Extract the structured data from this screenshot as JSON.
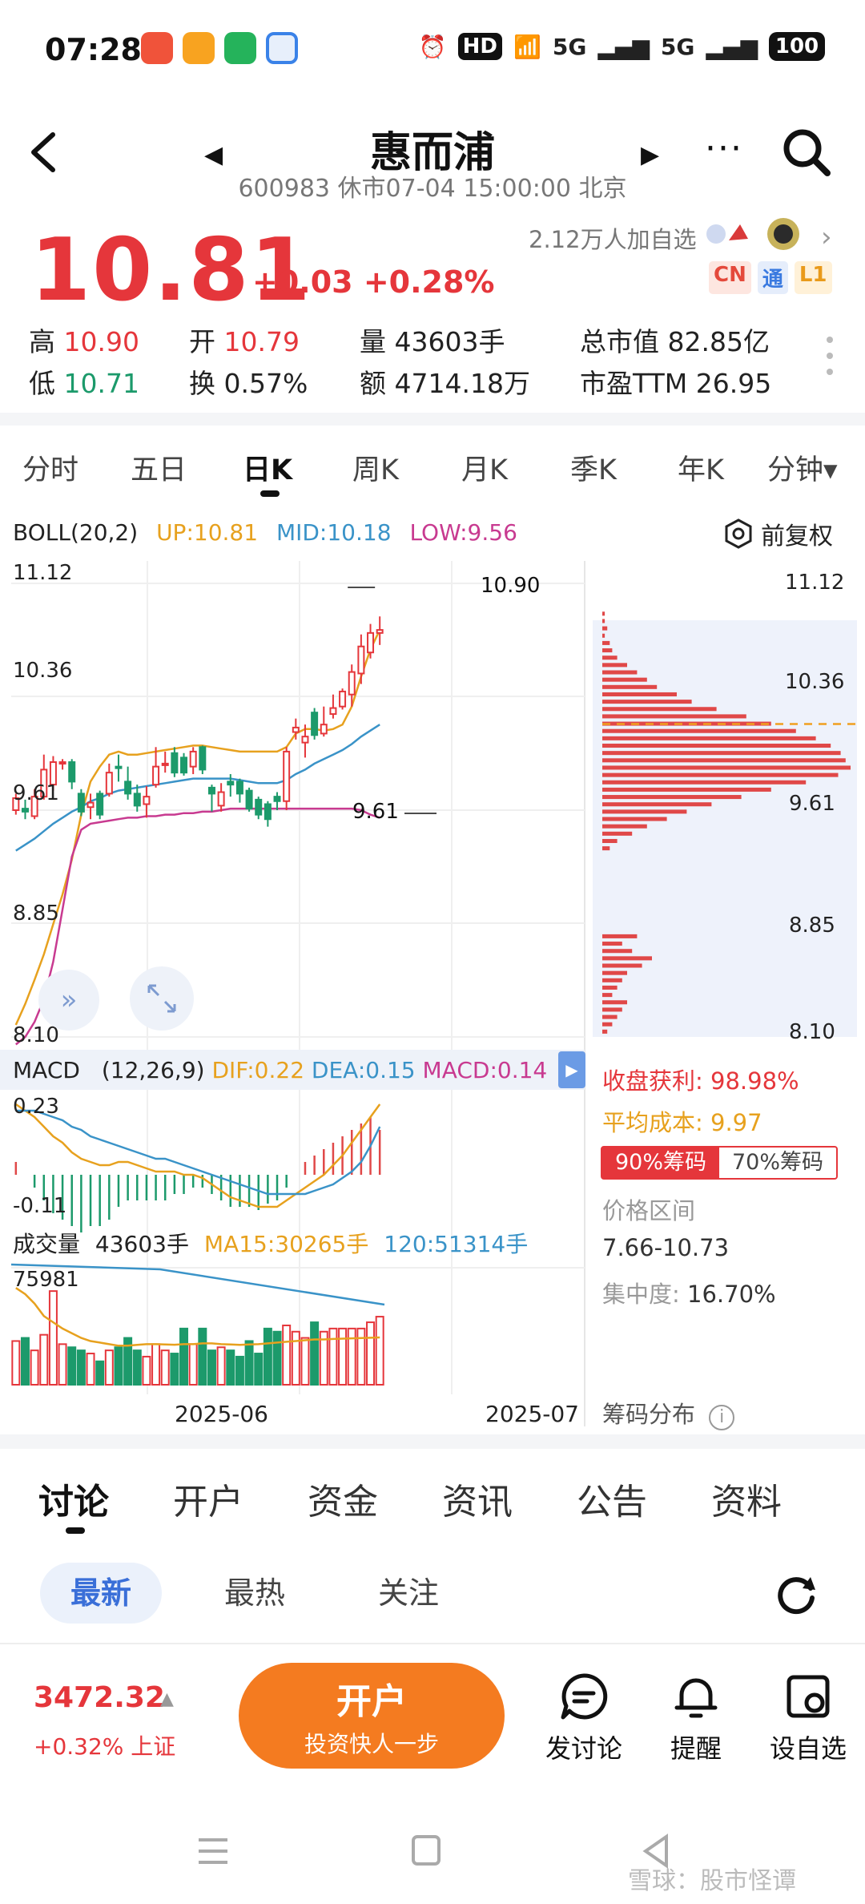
{
  "status_bar": {
    "time": "07:28",
    "hd": "HD",
    "net1": "5G",
    "net2": "5G",
    "battery": "100"
  },
  "header": {
    "title": "惠而浦",
    "subtitle": "600983 休市07-04 15:00:00 北京"
  },
  "quote": {
    "price": "10.81",
    "change": "+0.03 +0.28%",
    "watchers": "2.12万人加自选",
    "badges": [
      "CN",
      "通",
      "L1"
    ]
  },
  "stats": {
    "high_label": "高",
    "high": "10.90",
    "open_label": "开",
    "open": "10.79",
    "vol_label": "量",
    "vol": "43603手",
    "mcap_label": "总市值",
    "mcap": "82.85亿",
    "low_label": "低",
    "low": "10.71",
    "turn_label": "换",
    "turn": "0.57%",
    "amt_label": "额",
    "amt": "4714.18万",
    "pe_label": "市盈TTM",
    "pe": "26.95"
  },
  "period_tabs": [
    "分时",
    "五日",
    "日K",
    "周K",
    "月K",
    "季K",
    "年K",
    "分钟▾"
  ],
  "boll": {
    "name": "BOLL(20,2)",
    "up": "UP:10.81",
    "mid": "MID:10.18",
    "low": "LOW:9.56",
    "fq": "前复权"
  },
  "chart_axis": {
    "main_left": [
      "11.12",
      "10.36",
      "9.61",
      "8.85",
      "8.10"
    ],
    "main_right": [
      "11.12",
      "10.36",
      "9.61",
      "8.85",
      "8.10"
    ],
    "max_label": "10.90",
    "min_label": "9.61",
    "macd_left": [
      "0.23",
      "-0.11"
    ],
    "vol_left": [
      "75981"
    ],
    "x_dates": [
      "2025-06",
      "2025-07"
    ]
  },
  "macd": {
    "name": "MACD",
    "params": "(12,26,9)",
    "dif": "DIF:0.22",
    "dea": "DEA:0.15",
    "macd": "MACD:0.14"
  },
  "volume": {
    "name": "成交量",
    "cur": "43603手",
    "ma15": "MA15:30265手",
    "ma120": "120:51314手"
  },
  "chips": {
    "profit_label": "收盘获利:",
    "profit": "98.98%",
    "avg_label": "平均成本:",
    "avg": "9.97",
    "tab_on": "90%筹码",
    "tab_off": "70%筹码",
    "range_label": "价格区间",
    "range": "7.66-10.73",
    "conc_label": "集中度:",
    "conc": "16.70%",
    "dist_label": "筹码分布"
  },
  "chart_data": {
    "type": "bar",
    "title": "",
    "candles": [
      {
        "o": 9.61,
        "c": 9.69,
        "h": 9.72,
        "l": 9.58
      },
      {
        "o": 9.62,
        "c": 9.6,
        "h": 9.68,
        "l": 9.55
      },
      {
        "o": 9.57,
        "c": 9.7,
        "h": 9.75,
        "l": 9.55
      },
      {
        "o": 9.7,
        "c": 9.88,
        "h": 9.98,
        "l": 9.68
      },
      {
        "o": 9.78,
        "c": 9.93,
        "h": 9.97,
        "l": 9.74
      },
      {
        "o": 9.93,
        "c": 9.93,
        "h": 9.95,
        "l": 9.88
      },
      {
        "o": 9.93,
        "c": 9.8,
        "h": 9.95,
        "l": 9.75
      },
      {
        "o": 9.72,
        "c": 9.6,
        "h": 9.75,
        "l": 9.57
      },
      {
        "o": 9.63,
        "c": 9.66,
        "h": 9.72,
        "l": 9.55
      },
      {
        "o": 9.72,
        "c": 9.58,
        "h": 9.74,
        "l": 9.55
      },
      {
        "o": 9.72,
        "c": 9.86,
        "h": 9.92,
        "l": 9.7
      },
      {
        "o": 9.9,
        "c": 9.89,
        "h": 9.98,
        "l": 9.8
      },
      {
        "o": 9.8,
        "c": 9.72,
        "h": 9.9,
        "l": 9.68
      },
      {
        "o": 9.72,
        "c": 9.64,
        "h": 9.78,
        "l": 9.6
      },
      {
        "o": 9.65,
        "c": 9.7,
        "h": 9.77,
        "l": 9.56
      },
      {
        "o": 9.78,
        "c": 9.9,
        "h": 10.03,
        "l": 9.76
      },
      {
        "o": 9.91,
        "c": 9.92,
        "h": 10.0,
        "l": 9.86
      },
      {
        "o": 9.99,
        "c": 9.86,
        "h": 10.03,
        "l": 9.83
      },
      {
        "o": 9.96,
        "c": 9.86,
        "h": 9.99,
        "l": 9.84
      },
      {
        "o": 9.9,
        "c": 10.0,
        "h": 10.03,
        "l": 9.85
      },
      {
        "o": 10.03,
        "c": 9.88,
        "h": 10.04,
        "l": 9.85
      },
      {
        "o": 9.76,
        "c": 9.72,
        "h": 9.78,
        "l": 9.6
      },
      {
        "o": 9.64,
        "c": 9.73,
        "h": 9.79,
        "l": 9.6
      },
      {
        "o": 9.8,
        "c": 9.78,
        "h": 9.85,
        "l": 9.7
      },
      {
        "o": 9.8,
        "c": 9.72,
        "h": 9.82,
        "l": 9.66
      },
      {
        "o": 9.74,
        "c": 9.62,
        "h": 9.76,
        "l": 9.6
      },
      {
        "o": 9.68,
        "c": 9.58,
        "h": 9.7,
        "l": 9.55
      },
      {
        "o": 9.65,
        "c": 9.55,
        "h": 9.67,
        "l": 9.5
      },
      {
        "o": 9.7,
        "c": 9.67,
        "h": 9.73,
        "l": 9.61
      },
      {
        "o": 9.67,
        "c": 10.0,
        "h": 10.03,
        "l": 9.61
      },
      {
        "o": 10.13,
        "c": 10.16,
        "h": 10.22,
        "l": 10.08
      },
      {
        "o": 10.06,
        "c": 10.1,
        "h": 10.18,
        "l": 9.96
      },
      {
        "o": 10.26,
        "c": 10.11,
        "h": 10.29,
        "l": 10.08
      },
      {
        "o": 10.12,
        "c": 10.18,
        "h": 10.3,
        "l": 10.1
      },
      {
        "o": 10.25,
        "c": 10.29,
        "h": 10.38,
        "l": 10.22
      },
      {
        "o": 10.3,
        "c": 10.4,
        "h": 10.42,
        "l": 10.28
      },
      {
        "o": 10.38,
        "c": 10.53,
        "h": 10.58,
        "l": 10.3
      },
      {
        "o": 10.52,
        "c": 10.7,
        "h": 10.78,
        "l": 10.45
      },
      {
        "o": 10.66,
        "c": 10.79,
        "h": 10.85,
        "l": 10.62
      },
      {
        "o": 10.79,
        "c": 10.81,
        "h": 10.9,
        "l": 10.71
      }
    ],
    "boll_up": [
      8.18,
      8.32,
      8.48,
      8.65,
      8.85,
      9.05,
      9.28,
      9.58,
      9.8,
      9.9,
      9.98,
      10.0,
      9.98,
      9.98,
      9.99,
      10.0,
      10.01,
      10.02,
      10.03,
      10.04,
      10.04,
      10.03,
      10.02,
      10.01,
      10.0,
      10.0,
      10.0,
      10.0,
      10.0,
      10.03,
      10.12,
      10.15,
      10.15,
      10.14,
      10.15,
      10.18,
      10.3,
      10.5,
      10.68,
      10.81
    ],
    "boll_mid": [
      9.34,
      9.38,
      9.42,
      9.47,
      9.52,
      9.56,
      9.6,
      9.63,
      9.67,
      9.69,
      9.72,
      9.74,
      9.75,
      9.76,
      9.77,
      9.78,
      9.79,
      9.8,
      9.81,
      9.82,
      9.82,
      9.82,
      9.82,
      9.82,
      9.81,
      9.8,
      9.79,
      9.79,
      9.79,
      9.81,
      9.85,
      9.88,
      9.92,
      9.95,
      9.98,
      10.01,
      10.05,
      10.1,
      10.14,
      10.18
    ],
    "boll_low": [
      8.05,
      8.1,
      8.2,
      8.35,
      8.6,
      8.95,
      9.3,
      9.48,
      9.52,
      9.53,
      9.54,
      9.55,
      9.56,
      9.56,
      9.57,
      9.57,
      9.58,
      9.58,
      9.59,
      9.59,
      9.6,
      9.6,
      9.61,
      9.62,
      9.62,
      9.62,
      9.62,
      9.62,
      9.62,
      9.62,
      9.62,
      9.62,
      9.62,
      9.62,
      9.62,
      9.62,
      9.62,
      9.61,
      9.58,
      9.56
    ],
    "ylim": [
      8.1,
      11.12
    ],
    "dif": [
      0.22,
      0.2,
      0.18,
      0.15,
      0.12,
      0.1,
      0.07,
      0.05,
      0.04,
      0.03,
      0.03,
      0.04,
      0.04,
      0.03,
      0.02,
      0.01,
      0.01,
      0.01,
      0.0,
      0.0,
      -0.01,
      -0.03,
      -0.05,
      -0.07,
      -0.08,
      -0.09,
      -0.1,
      -0.1,
      -0.1,
      -0.08,
      -0.06,
      -0.04,
      -0.02,
      0.0,
      0.03,
      0.06,
      0.1,
      0.14,
      0.18,
      0.22
    ],
    "dea": [
      0.2,
      0.2,
      0.2,
      0.19,
      0.18,
      0.17,
      0.15,
      0.14,
      0.12,
      0.11,
      0.1,
      0.09,
      0.08,
      0.07,
      0.06,
      0.05,
      0.05,
      0.04,
      0.03,
      0.02,
      0.01,
      0.0,
      -0.01,
      -0.02,
      -0.03,
      -0.04,
      -0.05,
      -0.06,
      -0.06,
      -0.06,
      -0.06,
      -0.06,
      -0.05,
      -0.04,
      -0.03,
      -0.01,
      0.01,
      0.04,
      0.09,
      0.15
    ],
    "macd_hist": [
      0.04,
      0.0,
      -0.04,
      -0.08,
      -0.12,
      -0.14,
      -0.16,
      -0.18,
      -0.16,
      -0.16,
      -0.14,
      -0.1,
      -0.08,
      -0.08,
      -0.08,
      -0.08,
      -0.08,
      -0.06,
      -0.06,
      -0.04,
      -0.04,
      -0.06,
      -0.08,
      -0.1,
      -0.1,
      -0.1,
      -0.11,
      -0.09,
      -0.08,
      -0.04,
      0.0,
      0.04,
      0.06,
      0.08,
      0.1,
      0.12,
      0.14,
      0.16,
      0.18,
      0.14
    ],
    "macd_ylim": [
      -0.11,
      0.23
    ],
    "volume": [
      28000,
      30000,
      22000,
      32000,
      60000,
      26000,
      24000,
      22000,
      20000,
      15000,
      22000,
      24000,
      30000,
      22000,
      18000,
      26000,
      22000,
      20000,
      36000,
      26000,
      36000,
      22000,
      24000,
      22000,
      18000,
      28000,
      20000,
      36000,
      34000,
      38000,
      34000,
      30000,
      40000,
      34000,
      36000,
      36000,
      36000,
      36000,
      40000,
      43603
    ],
    "vol_ma15": [
      62000,
      58000,
      52000,
      44000,
      40000,
      36000,
      33000,
      30000,
      28000,
      27000,
      26000,
      25000,
      25000,
      25500,
      26000,
      26000,
      25800,
      25600,
      26000,
      26000,
      26500,
      26500,
      26000,
      25800,
      25500,
      25800,
      26000,
      26500,
      27000,
      27500,
      28000,
      28500,
      29000,
      29000,
      29300,
      29500,
      29700,
      29900,
      30100,
      30265
    ],
    "vol_ylim": [
      0,
      75981
    ],
    "chips_profile": [
      0,
      0,
      1,
      1,
      2,
      1,
      3,
      4,
      6,
      10,
      14,
      18,
      22,
      30,
      36,
      46,
      58,
      68,
      78,
      86,
      92,
      96,
      98,
      100,
      95,
      82,
      68,
      56,
      44,
      34,
      26,
      18,
      12,
      6,
      3,
      0,
      0,
      0,
      0,
      0,
      0,
      0,
      0,
      0,
      0,
      0,
      14,
      8,
      12,
      20,
      16,
      10,
      8,
      6,
      4,
      10,
      8,
      6,
      4,
      2
    ],
    "up_color": "#e5363b",
    "down_color": "#1c9a6b"
  },
  "bottom_tabs": [
    "讨论",
    "开户",
    "资金",
    "资讯",
    "公告",
    "资料"
  ],
  "pills": [
    "最新",
    "最热",
    "关注"
  ],
  "index": {
    "value": "3472.32",
    "change": "+0.32% 上证"
  },
  "open_account": {
    "title": "开户",
    "subtitle": "投资快人一步"
  },
  "actions": {
    "post": "发讨论",
    "alert": "提醒",
    "watch": "设自选"
  },
  "watermark": "雪球：股市怪谭"
}
